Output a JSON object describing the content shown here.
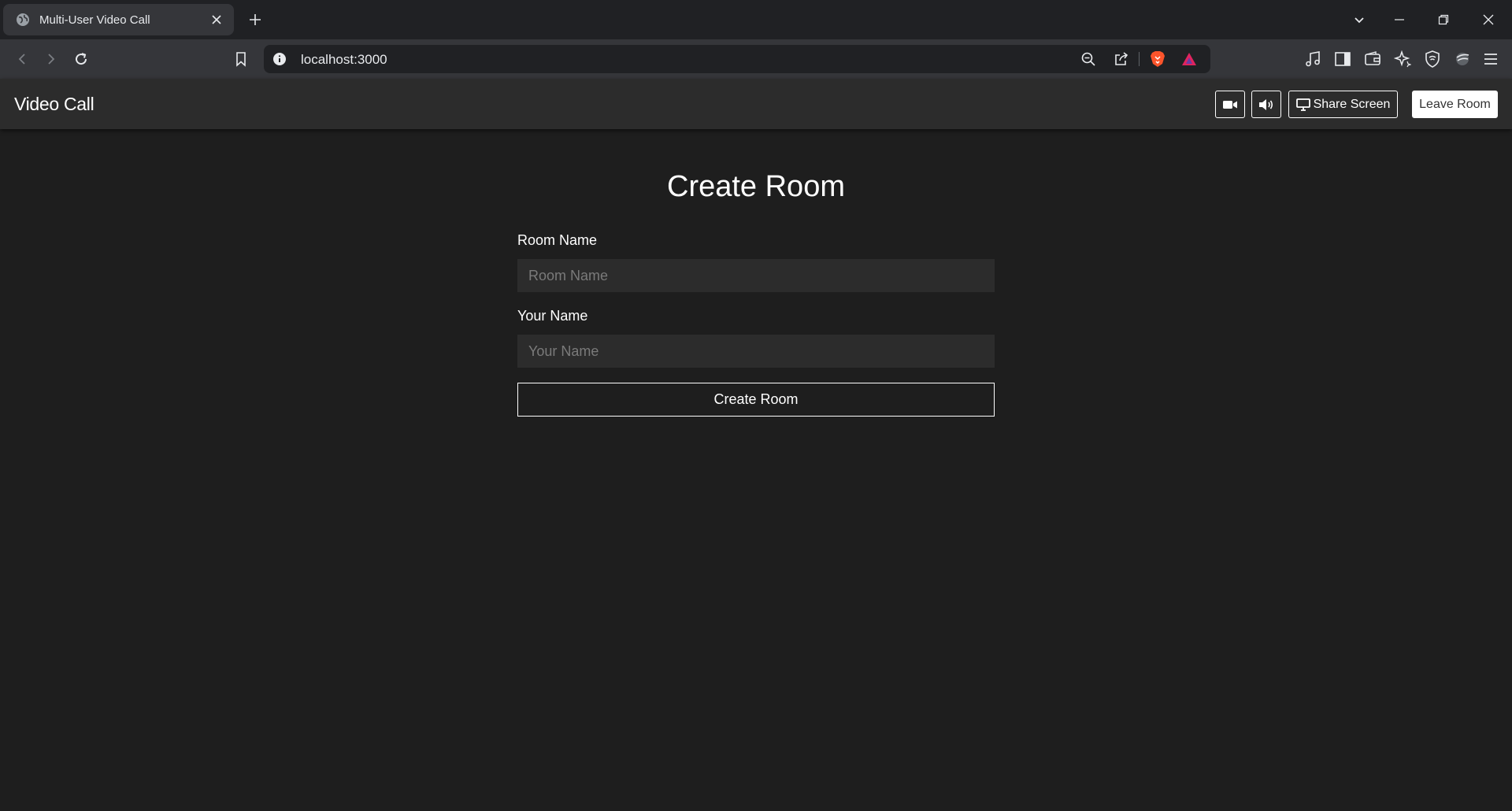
{
  "browser": {
    "tab": {
      "title": "Multi-User Video Call",
      "favicon": "globe-icon"
    },
    "address": {
      "url": "localhost:3000"
    }
  },
  "navbar": {
    "brand": "Video Call",
    "controls": {
      "camera_icon": "video-camera-icon",
      "audio_icon": "speaker-icon",
      "share_label": "Share Screen",
      "leave_label": "Leave Room"
    }
  },
  "form": {
    "title": "Create Room",
    "room_name_label": "Room Name",
    "room_name_placeholder": "Room Name",
    "room_name_value": "",
    "your_name_label": "Your Name",
    "your_name_placeholder": "Your Name",
    "your_name_value": "",
    "submit_label": "Create Room"
  },
  "colors": {
    "page_bg": "#1e1e1e",
    "navbar_bg": "#2c2c2c",
    "input_bg": "#2c2c2c",
    "text": "#ffffff"
  }
}
